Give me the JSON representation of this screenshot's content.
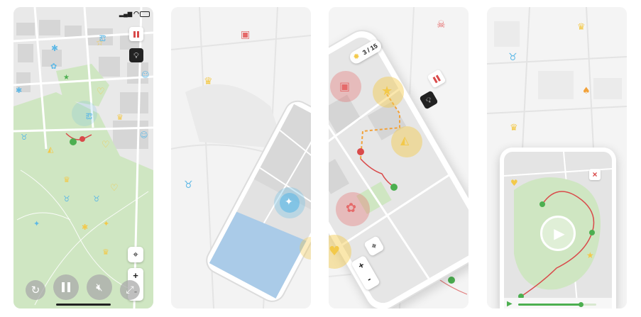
{
  "colors": {
    "park_green": "#cfe6c2",
    "route_red": "#d94a4a",
    "route_orange": "#f2a23a",
    "icon_blue": "#5db8e6",
    "icon_yellow": "#f3c94a",
    "icon_red": "#e56a6a",
    "water_blue": "#aacbe8",
    "ui_dark": "#222222",
    "accent_green": "#4caf50"
  },
  "panel1": {
    "pause_icon": "pause-icon",
    "hint_icon": "lightbulb-icon",
    "locate_icon": "crosshair-icon",
    "zoom_in_label": "+",
    "zoom_out_label": "-",
    "controls": [
      "restart-icon",
      "pause-icon",
      "mute-icon",
      "expand-icon"
    ]
  },
  "panel3": {
    "progress_text": "3 / 15",
    "star_icon": "sun-icon",
    "pause_icon": "pause-icon",
    "hint_icon": "lightbulb-icon",
    "locate_icon": "crosshair-icon",
    "zoom_in_label": "+",
    "zoom_out_label": "-"
  },
  "panel4": {
    "close_label": "×",
    "play_icon": "play-icon",
    "progress_fraction": 0.8
  }
}
